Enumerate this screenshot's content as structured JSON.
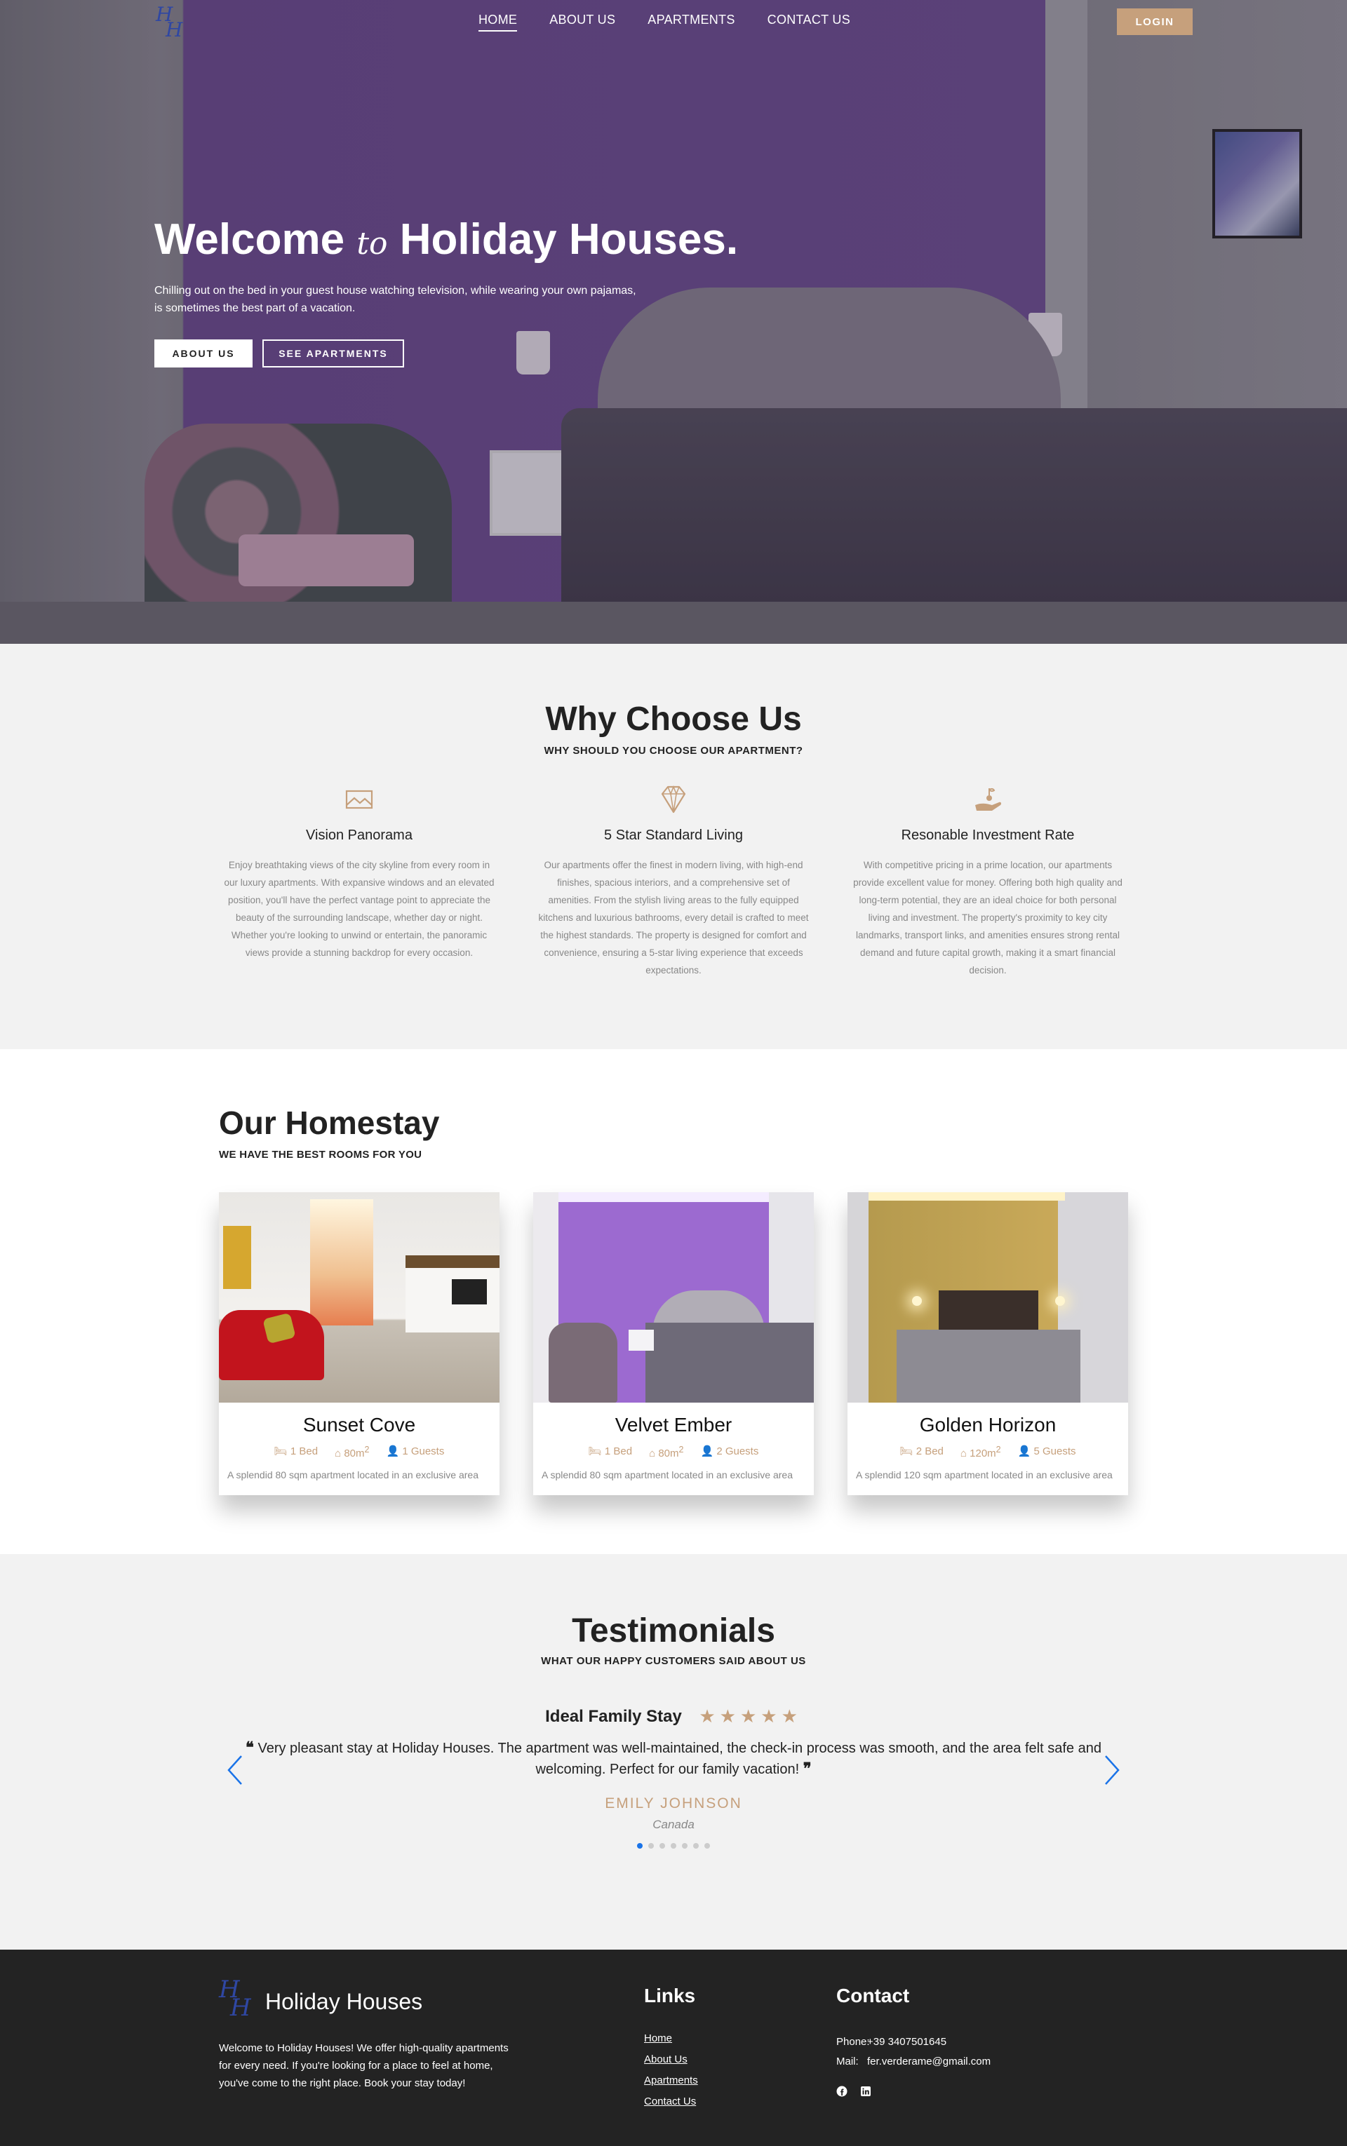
{
  "nav": {
    "logo_top": "H",
    "logo_bottom": "H",
    "items": [
      {
        "label": "HOME",
        "active": true
      },
      {
        "label": "ABOUT US",
        "active": false
      },
      {
        "label": "APARTMENTS",
        "active": false
      },
      {
        "label": "CONTACT US",
        "active": false
      }
    ],
    "login_label": "LOGIN"
  },
  "hero": {
    "title_start": "Welcome",
    "title_italic": "to",
    "title_end": "Holiday Houses.",
    "subtitle_line1": "Chilling out on the bed in your guest house watching television, while wearing your own pajamas,",
    "subtitle_line2": "is sometimes the best part of a vacation.",
    "btn_about": "ABOUT US",
    "btn_apartments": "SEE APARTMENTS"
  },
  "why": {
    "title": "Why Choose Us",
    "subtitle": "WHY SHOULD YOU CHOOSE OUR APARTMENT?",
    "features": [
      {
        "icon": "landscape-icon",
        "title": "Vision Panorama",
        "text": "Enjoy breathtaking views of the city skyline from every room in our luxury apartments. With expansive windows and an elevated position, you'll have the perfect vantage point to appreciate the beauty of the surrounding landscape, whether day or night. Whether you're looking to unwind or entertain, the panoramic views provide a stunning backdrop for every occasion."
      },
      {
        "icon": "diamond-icon",
        "title": "5 Star Standard Living",
        "text": "Our apartments offer the finest in modern living, with high-end finishes, spacious interiors, and a comprehensive set of amenities. From the stylish living areas to the fully equipped kitchens and luxurious bathrooms, every detail is crafted to meet the highest standards. The property is designed for comfort and convenience, ensuring a 5-star living experience that exceeds expectations."
      },
      {
        "icon": "investment-icon",
        "title": "Resonable Investment Rate",
        "text": "With competitive pricing in a prime location, our apartments provide excellent value for money. Offering both high quality and long-term potential, they are an ideal choice for both personal living and investment. The property's proximity to key city landmarks, transport links, and amenities ensures strong rental demand and future capital growth, making it a smart financial decision."
      }
    ]
  },
  "homestay": {
    "title": "Our Homestay",
    "subtitle": "WE HAVE THE BEST ROOMS FOR YOU",
    "cards": [
      {
        "name": "Sunset Cove",
        "beds": "1 Bed",
        "area": "80m",
        "sup": "2",
        "guests": "1 Guests",
        "desc": "A splendid 80 sqm apartment located in an exclusive area"
      },
      {
        "name": "Velvet Ember",
        "beds": "1 Bed",
        "area": "80m",
        "sup": "2",
        "guests": "2 Guests",
        "desc": "A splendid 80 sqm apartment located in an exclusive area"
      },
      {
        "name": "Golden Horizon",
        "beds": "2 Bed",
        "area": "120m",
        "sup": "2",
        "guests": "5 Guests",
        "desc": "A splendid 120 sqm apartment located in an exclusive area"
      }
    ]
  },
  "testimonials": {
    "title": "Testimonials",
    "subtitle": "WHAT OUR HAPPY CUSTOMERS SAID ABOUT US",
    "review_title": "Ideal Family Stay",
    "stars": "★★★★★",
    "rating": 5,
    "quote_open": "❝",
    "quote": "Very pleasant stay at Holiday Houses. The apartment was well-maintained, the check-in process was smooth, and the area felt safe and welcoming. Perfect for our family vacation!",
    "quote_close": "❞",
    "name": "EMILY JOHNSON",
    "country": "Canada",
    "slide_count": 7,
    "active_slide": 1
  },
  "footer": {
    "brand": "Holiday Houses",
    "about": "Welcome to Holiday Houses! We offer high-quality apartments for every need. If you're looking for a place to feel at home, you've come to the right place. Book your stay today!",
    "links_title": "Links",
    "links": [
      "Home",
      "About Us",
      "Apartments",
      "Contact Us"
    ],
    "contact_title": "Contact",
    "phone_label": "Phone:",
    "phone": "+39 3407501645",
    "mail_label": "Mail:",
    "mail": "fer.verderame@gmail.com",
    "social": [
      "facebook-icon",
      "linkedin-icon"
    ]
  },
  "colors": {
    "accent": "#c6a07c",
    "dark": "#232323",
    "section_bg": "#f2f2f2",
    "dot_active": "#1a73e8"
  }
}
